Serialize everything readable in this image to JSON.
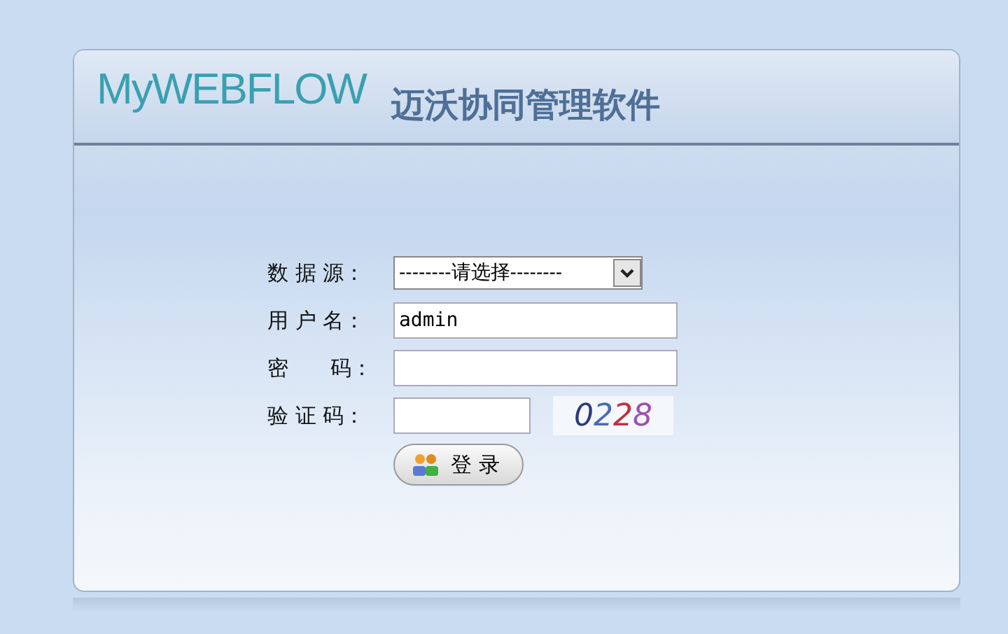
{
  "header": {
    "logo": "MyWEBFLOW",
    "title": "迈沃协同管理软件"
  },
  "form": {
    "fields": [
      {
        "kind": "select",
        "label": "数 据 源：",
        "value": "--------请选择--------"
      },
      {
        "kind": "text",
        "label": "用 户 名：",
        "value": "admin"
      },
      {
        "kind": "password",
        "label": "密　　码："
      },
      {
        "kind": "captcha",
        "label": "验 证 码：",
        "captcha": "0228"
      }
    ],
    "button": "登 录"
  }
}
